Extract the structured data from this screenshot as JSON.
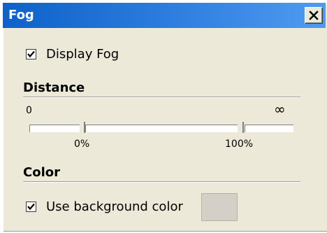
{
  "window": {
    "title": "Fog",
    "close_glyph": "✕"
  },
  "display_fog": {
    "label": "Display Fog",
    "checked": true
  },
  "distance": {
    "heading": "Distance",
    "min_label": "0",
    "max_label": "∞",
    "near_percent_label": "0%",
    "far_percent_label": "100%"
  },
  "color": {
    "heading": "Color",
    "use_background_label": "Use background color",
    "use_background_checked": true,
    "swatch_color": "#d4d0c8"
  },
  "colors": {
    "title_bar": "#2f7fe0",
    "window_bg": "#ece9d8"
  }
}
